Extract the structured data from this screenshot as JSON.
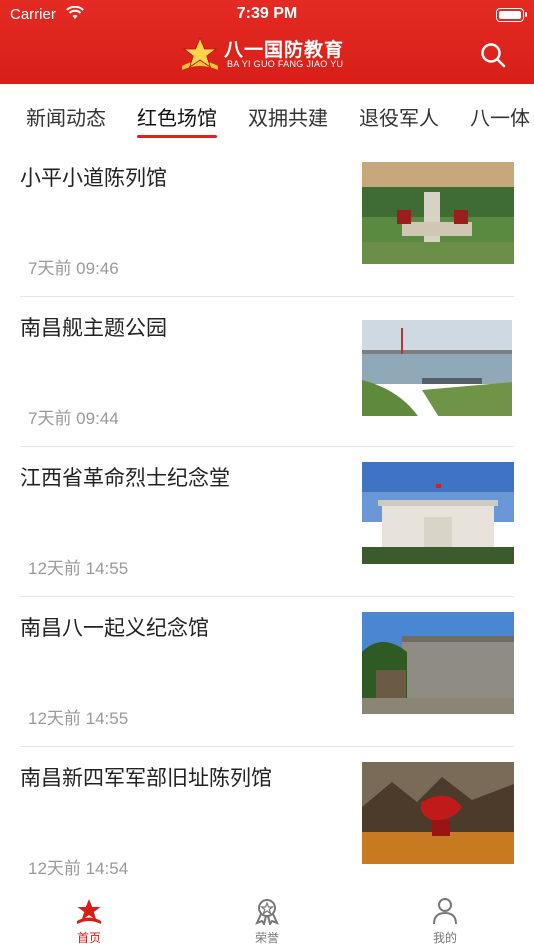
{
  "status_bar": {
    "carrier": "Carrier",
    "time": "7:39 PM"
  },
  "header": {
    "logo_cn": "八一国防教育",
    "logo_pinyin": "BA YI GUO FANG JIAO YU",
    "search_icon": "search-icon"
  },
  "tabs": [
    {
      "label": "新闻动态"
    },
    {
      "label": "红色场馆"
    },
    {
      "label": "双拥共建"
    },
    {
      "label": "退役军人"
    },
    {
      "label": "八一体"
    }
  ],
  "active_tab": "红色场馆",
  "articles": [
    {
      "title": "小平小道陈列馆",
      "time": "7天前 09:46"
    },
    {
      "title": "南昌舰主题公园",
      "time": "7天前 09:44"
    },
    {
      "title": "江西省革命烈士纪念堂",
      "time": "12天前 14:55"
    },
    {
      "title": "南昌八一起义纪念馆",
      "time": "12天前 14:55"
    },
    {
      "title": "南昌新四军军部旧址陈列馆",
      "time": "12天前 14:54"
    }
  ],
  "tabbar": [
    {
      "label": "首页",
      "icon": "home-star-icon",
      "active": true
    },
    {
      "label": "荣誉",
      "icon": "medal-icon",
      "active": false
    },
    {
      "label": "我的",
      "icon": "profile-icon",
      "active": false
    }
  ],
  "colors": {
    "brand_red": "#d81e18",
    "tab_underline": "#e02020"
  }
}
